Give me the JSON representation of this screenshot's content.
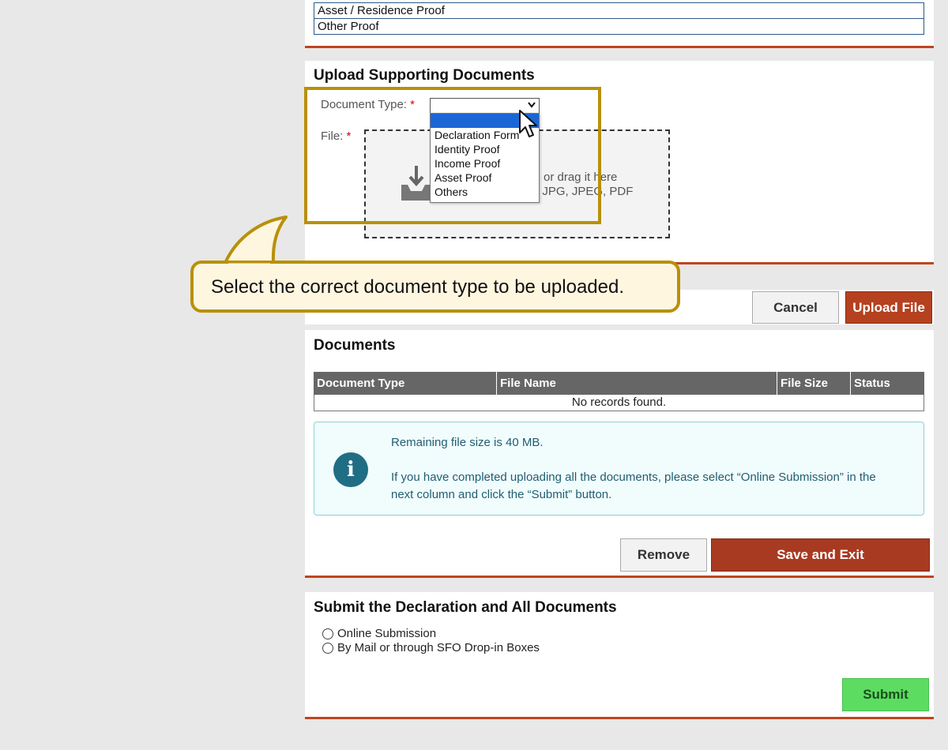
{
  "proof_table": {
    "rows": [
      "Asset / Residence Proof",
      "Other Proof"
    ]
  },
  "upload": {
    "title": "Upload Supporting Documents",
    "doc_type_label": "Document Type:",
    "file_label": "File:",
    "required_mark": "*",
    "select_value": "",
    "dropzone_line1": "or drag it here",
    "dropzone_line2": ": JPG, JPEG, PDF",
    "dropdown_options": [
      "Declaration Form",
      "Identity Proof",
      "Income Proof",
      "Asset Proof",
      "Others"
    ]
  },
  "buttons": {
    "cancel": "Cancel",
    "upload_file": "Upload File",
    "remove": "Remove",
    "save_exit": "Save and Exit",
    "submit": "Submit"
  },
  "documents": {
    "title": "Documents",
    "columns": [
      "Document Type",
      "File Name",
      "File Size",
      "Status"
    ],
    "empty_text": "No records found.",
    "info_line1": "Remaining file size is 40 MB.",
    "info_line2": "If you have completed uploading all the documents, please select “Online Submission” in the",
    "info_line3": "next column and click the “Submit” button."
  },
  "submit_section": {
    "title": "Submit the Declaration and All Documents",
    "options": [
      "Online Submission",
      "By Mail or through SFO Drop-in Boxes"
    ]
  },
  "callout": {
    "text": "Select the correct document type to be uploaded."
  },
  "colors": {
    "accent_red": "#a83a22",
    "divider": "#c0441e",
    "highlight_gold": "#b8900a",
    "submit_green": "#5ddc62",
    "info_teal": "#1f6e84"
  }
}
